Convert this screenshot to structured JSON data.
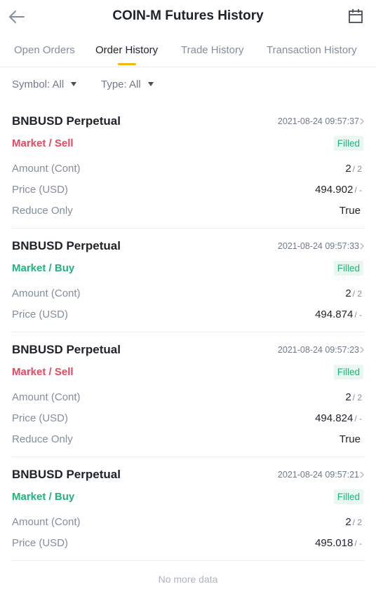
{
  "header": {
    "title": "COIN-M Futures History"
  },
  "tabs": [
    {
      "label": "Open Orders",
      "active": false
    },
    {
      "label": "Order History",
      "active": true
    },
    {
      "label": "Trade History",
      "active": false
    },
    {
      "label": "Transaction History",
      "active": false
    }
  ],
  "filters": {
    "symbol": "Symbol: All",
    "type": "Type: All"
  },
  "labels": {
    "amount": "Amount (Cont)",
    "price": "Price (USD)",
    "reduce_only": "Reduce Only"
  },
  "orders": [
    {
      "symbol": "BNBUSD Perpetual",
      "time": "2021-08-24 09:57:37",
      "side": "Market / Sell",
      "status": "Filled",
      "amount": "2",
      "amount_sub": "/ 2",
      "price": "494.902",
      "price_sub": "/ -",
      "reduce_only": "True"
    },
    {
      "symbol": "BNBUSD Perpetual",
      "time": "2021-08-24 09:57:33",
      "side": "Market / Buy",
      "status": "Filled",
      "amount": "2",
      "amount_sub": "/ 2",
      "price": "494.874",
      "price_sub": "/ -"
    },
    {
      "symbol": "BNBUSD Perpetual",
      "time": "2021-08-24 09:57:23",
      "side": "Market / Sell",
      "status": "Filled",
      "amount": "2",
      "amount_sub": "/ 2",
      "price": "494.824",
      "price_sub": "/ -",
      "reduce_only": "True"
    },
    {
      "symbol": "BNBUSD Perpetual",
      "time": "2021-08-24 09:57:21",
      "side": "Market / Buy",
      "status": "Filled",
      "amount": "2",
      "amount_sub": "/ 2",
      "price": "495.018",
      "price_sub": "/ -"
    }
  ],
  "footer": {
    "no_more": "No more data"
  },
  "colors": {
    "accent": "#f0b90b",
    "sell": "#e8485f",
    "buy": "#1fb57a"
  }
}
